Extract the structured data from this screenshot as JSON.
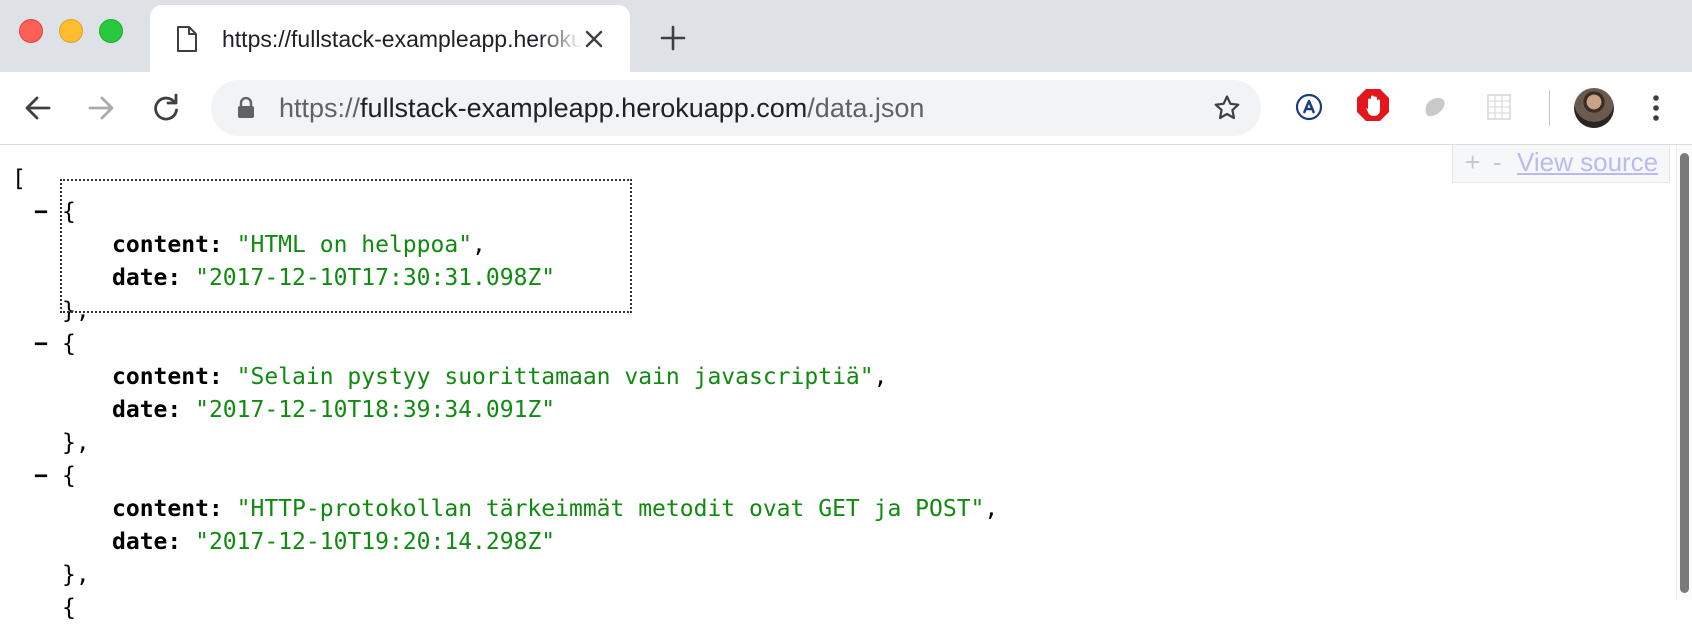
{
  "tab": {
    "title": "https://fullstack-exampleapp.herokuapp.com/data.json"
  },
  "address_bar": {
    "scheme": "https://",
    "host": "fullstack-exampleapp.herokuapp.com",
    "path": "/data.json"
  },
  "viewer": {
    "plus": "+",
    "minus": "-",
    "view_source": "View source"
  },
  "json": {
    "open_bracket": "[",
    "collapse_glyph": "−",
    "open_brace": "{",
    "close_brace": "},",
    "key_content": "content:",
    "key_date": "date:",
    "items": [
      {
        "content": "\"HTML on helppoa\"",
        "date": "\"2017-12-10T17:30:31.098Z\""
      },
      {
        "content": "\"Selain pystyy suorittamaan vain javascriptiä\"",
        "date": "\"2017-12-10T18:39:34.091Z\""
      },
      {
        "content": "\"HTTP-protokollan tärkeimmät metodit ovat GET ja POST\"",
        "date": "\"2017-12-10T19:20:14.298Z\""
      }
    ]
  },
  "colors": {
    "string": "#108a10",
    "tabstrip": "#dee1e6",
    "omnibox": "#f1f3f4"
  }
}
